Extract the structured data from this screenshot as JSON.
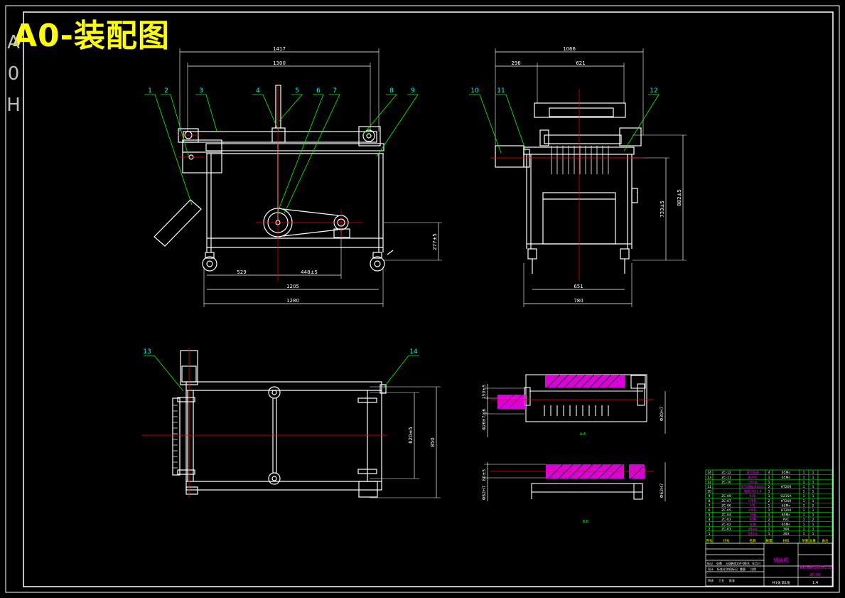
{
  "title": "A0-装配图",
  "side_letters": [
    "A",
    "0",
    "H"
  ],
  "colors": {
    "background": "#000000",
    "frame": "#ffffff",
    "part": "#ffffff",
    "dimension": "#ffffff",
    "centerline": "#ff0000",
    "leader": "#00ff00",
    "balloon_text": "#00ffff",
    "hatch": "#ff00ff",
    "title": "#ffff00",
    "table": "#00ff00"
  },
  "front_view": {
    "dims": {
      "overall_top": "1417",
      "inner_top": "1300",
      "base_left": "529",
      "base_mid": "448±5",
      "base_inner": "1205",
      "base_overall": "1280",
      "right_height": "277±5"
    },
    "balloons": [
      "1",
      "2",
      "3",
      "4",
      "5",
      "6",
      "7",
      "8",
      "9"
    ]
  },
  "side_view": {
    "dims": {
      "overall_top": "1066",
      "top_left": "296",
      "top_mid": "621",
      "height_1": "733±5",
      "height_2": "882±5",
      "bottom_inner": "651",
      "bottom_overall": "780"
    },
    "balloons": [
      "10",
      "11",
      "12"
    ]
  },
  "top_view": {
    "dims": {
      "width_inner": "620±5",
      "width_overall": "850"
    },
    "balloons": [
      "13",
      "14"
    ]
  },
  "section_views": {
    "a": {
      "dims": {
        "left_small": "150±5",
        "left_fit": "Φ26H7/g6",
        "right_fit": "Φ30H7"
      },
      "label": "A-A"
    },
    "b": {
      "dims": {
        "left_small": "80±5",
        "left_fit": "Φ62H7",
        "right_fit": "Φ62H7"
      },
      "label": "B-B"
    }
  },
  "parts_list": {
    "rows": [
      {
        "no": "14",
        "code": "ZC-12",
        "name": "滚动轮子",
        "qty": "4",
        "material": "65Mn",
        "a": "1",
        "b": "1"
      },
      {
        "no": "13",
        "code": "ZC-11",
        "name": "皮带轮",
        "qty": "1",
        "material": "65Mn",
        "a": "1",
        "b": "1"
      },
      {
        "no": "12",
        "code": "ZC-10",
        "name": "刀片组",
        "qty": "1",
        "material": "",
        "a": "1",
        "b": "1"
      },
      {
        "no": "11",
        "code": "",
        "name": "深沟球轴承6205",
        "qty": "2",
        "material": "HT200",
        "a": "1",
        "b": "1"
      },
      {
        "no": "10",
        "code": "",
        "name": "电机Y801-4",
        "qty": "1",
        "material": "",
        "a": "1",
        "b": "1"
      },
      {
        "no": "9",
        "code": "ZC-09",
        "name": "机架",
        "qty": "1",
        "material": "Q235A",
        "a": "1",
        "b": "1"
      },
      {
        "no": "8",
        "code": "ZC-07",
        "name": "V带轮",
        "qty": "2",
        "material": "HT200",
        "a": "1",
        "b": "1"
      },
      {
        "no": "7",
        "code": "ZC-06",
        "name": "V带",
        "qty": "1",
        "material": "65Mn",
        "a": "1",
        "b": "2"
      },
      {
        "no": "6",
        "code": "ZC-05",
        "name": "V带轮",
        "qty": "1",
        "material": "HT200",
        "a": "1",
        "b": "1"
      },
      {
        "no": "5",
        "code": "ZC-04",
        "name": "刀轴",
        "qty": "1",
        "material": "65Mn",
        "a": "1",
        "b": "1"
      },
      {
        "no": "4",
        "code": "ZC-03",
        "name": "护罩",
        "qty": "2",
        "material": "PVC",
        "a": "1",
        "b": "2"
      },
      {
        "no": "3",
        "code": "ZC-02",
        "name": "压辊",
        "qty": "1",
        "material": "65Mn",
        "a": "1",
        "b": "1"
      },
      {
        "no": "2",
        "code": "ZC-01",
        "name": "进料斗",
        "qty": "1",
        "material": "304",
        "a": "1",
        "b": "1"
      },
      {
        "no": "1",
        "code": "",
        "name": "出料斗",
        "qty": "1",
        "material": "304",
        "a": "1",
        "b": "1"
      }
    ],
    "header": {
      "no": "序号",
      "code": "代号",
      "name": "名称",
      "qty": "数量",
      "material": "材料",
      "weight": "单重 总重",
      "note": "备注"
    }
  },
  "title_block": {
    "drawing_name": "切片机",
    "company": "某机械制造有限公司",
    "drawing_no": "ZC-00",
    "scale": "1:4",
    "sheet": "共1张 第1张",
    "labels": [
      "标记",
      "处数",
      "分区",
      "更改文件号",
      "签名",
      "年月日"
    ],
    "labels2": [
      "设计",
      "标准化",
      "阶段标记",
      "重量",
      "比例"
    ],
    "labels3": [
      "审核",
      "工艺",
      "批准"
    ]
  }
}
